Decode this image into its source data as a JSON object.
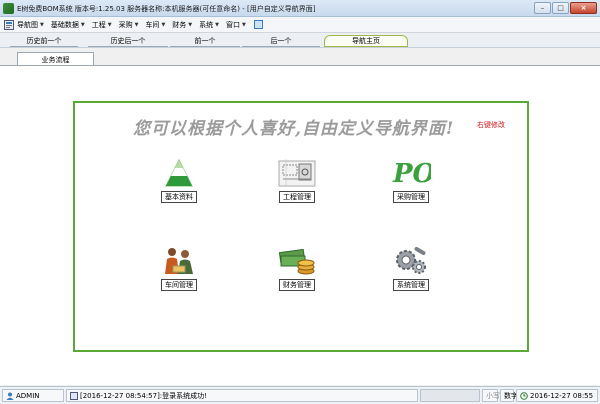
{
  "window": {
    "title": "E树免费BOM系统  版本号:1.25.03   服务器名称:本机服务器(可任意命名) - [用户自定义导航界面]",
    "btn_min": "–",
    "btn_max": "□",
    "btn_close": "×"
  },
  "menu": {
    "items": [
      {
        "label": "导航图"
      },
      {
        "label": "基础数据"
      },
      {
        "label": "工程"
      },
      {
        "label": "采购"
      },
      {
        "label": "车间"
      },
      {
        "label": "财务"
      },
      {
        "label": "系统"
      },
      {
        "label": "窗口"
      }
    ]
  },
  "navbar": {
    "buttons": [
      "历史前一个",
      "历史后一个",
      "前一个",
      "后一个",
      "导航主页"
    ],
    "active_index": 4
  },
  "tab": {
    "label": "业务流程"
  },
  "panel": {
    "headline": "您可以根据个人喜好,自由定义导航界面!",
    "right_click_hint": "右键修改",
    "modules": [
      {
        "label": "基本资料",
        "icon": "pyramid-icon"
      },
      {
        "label": "工程管理",
        "icon": "blueprint-icon"
      },
      {
        "label": "采购管理",
        "icon": "po-icon"
      },
      {
        "label": "车间管理",
        "icon": "workers-icon"
      },
      {
        "label": "财务管理",
        "icon": "money-icon"
      },
      {
        "label": "系统管理",
        "icon": "gears-icon"
      }
    ]
  },
  "statusbar": {
    "user": "ADMIN",
    "message": "[2016-12-27 08:54:57]:登录系统成功!",
    "mode": "小写",
    "numlock": "数字",
    "clock": "2016-12-27 08:55"
  },
  "colors": {
    "panel_border": "#5aa937",
    "hint_red": "#d01616",
    "headline_gray": "#9b9b9b"
  }
}
